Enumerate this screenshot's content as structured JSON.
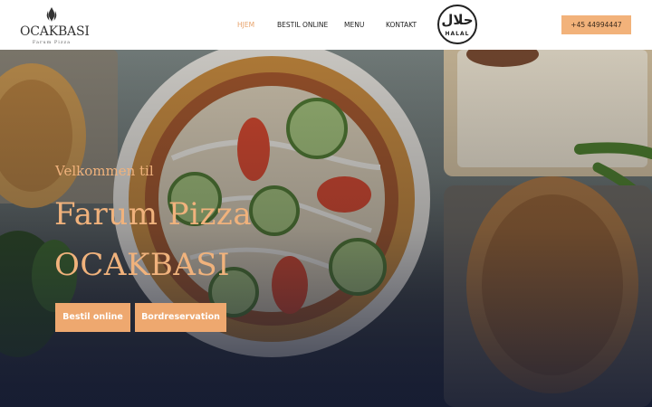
{
  "brand": {
    "name": "OCAKBASI",
    "tagline": "Farum Pizza"
  },
  "nav": {
    "items": [
      {
        "label": "HJEM",
        "active": true
      },
      {
        "label": "BESTIL ONLINE",
        "active": false
      },
      {
        "label": "MENU",
        "active": false
      },
      {
        "label": "KONTAKT",
        "active": false
      }
    ]
  },
  "halal_badge": {
    "arabic": "حلال",
    "text": "HALAL"
  },
  "phone": {
    "label": "+45 44994447"
  },
  "hero": {
    "welcome": "Velkommen til",
    "title_line1": "Farum Pizza",
    "title_line2": "OCAKBASI",
    "buttons": {
      "order": "Bestil online",
      "reservation": "Bordreservation"
    }
  },
  "colors": {
    "accent": "#f0b27c",
    "button": "#eea86f",
    "active_nav": "#e8a36b"
  }
}
